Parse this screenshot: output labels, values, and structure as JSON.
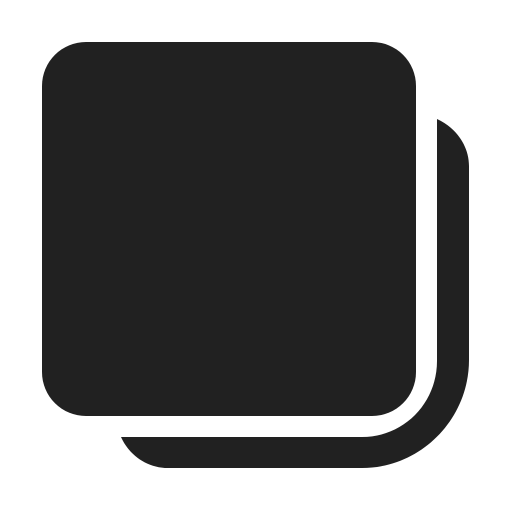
{
  "icon": {
    "name": "copy-icon",
    "description_semantic": "stacked squares",
    "color": "#212121",
    "background": "#ffffff"
  }
}
